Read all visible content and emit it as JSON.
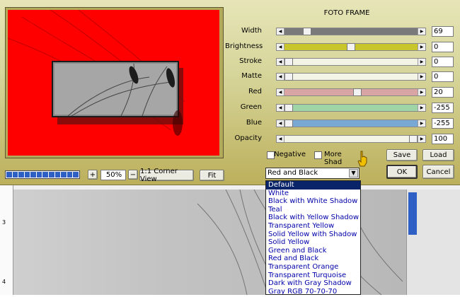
{
  "dialog_title": "FOTO FRAME",
  "sliders": [
    {
      "label": "Width",
      "value": "69",
      "color": "#7a7a7a",
      "level": 0.15
    },
    {
      "label": "Brightness",
      "value": "0",
      "color": "#c8c62a",
      "level": 0.5
    },
    {
      "label": "Stroke",
      "value": "0",
      "color": "#f3f3e6",
      "level": 0.0
    },
    {
      "label": "Matte",
      "value": "0",
      "color": "#f3f3e6",
      "level": 0.0
    },
    {
      "label": "Red",
      "value": "20",
      "color": "#d9a4a4",
      "level": 0.55
    },
    {
      "label": "Green",
      "value": "-255",
      "color": "#9fd4a7",
      "level": 0.0
    },
    {
      "label": "Blue",
      "value": "-255",
      "color": "#7aa8d4",
      "level": 0.0
    },
    {
      "label": "Opacity",
      "value": "100",
      "color": "#f3f3e6",
      "level": 1.0
    }
  ],
  "checkboxes": {
    "negative": "Negative",
    "more_shadow": "More Shad"
  },
  "buttons": {
    "save": "Save",
    "load": "Load",
    "ok": "OK",
    "cancel": "Cancel",
    "plus": "+",
    "minus": "−",
    "corner_view": "1:1 Corner View",
    "fit": "Fit"
  },
  "zoom": "50%",
  "frame_preset": {
    "selected": "Red and Black",
    "options": [
      "Default",
      "White",
      "Black with White Shadow",
      "Teal",
      "Black with Yellow Shadow",
      "Transparent Yellow",
      "Solid Yellow with Shadow",
      "Solid Yellow",
      "Green and Black",
      "Red and Black",
      "Transparent Orange",
      "Transparent Turquoise",
      "Dark with Gray Shadow",
      "Gray RGB 70-70-70"
    ],
    "highlighted": "Default"
  },
  "ruler_marks": [
    "3",
    "4"
  ],
  "colors": {
    "preview_bg": "#ff0000",
    "highlight": "#0a246a",
    "option_text": "#0000aa"
  }
}
